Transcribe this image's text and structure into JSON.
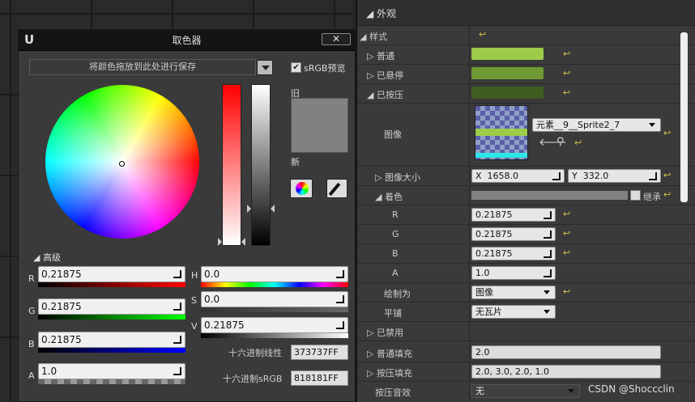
{
  "picker": {
    "title": "取色器",
    "save_bar": "将颜色拖放到此处进行保存",
    "srgb_label": "sRGB预览",
    "srgb_checked": true,
    "old_label": "旧",
    "new_label": "新",
    "advanced_label": "高级",
    "swatch_color": "#818181",
    "channels": [
      {
        "label": "R",
        "value": "0.21875"
      },
      {
        "label": "G",
        "value": "0.21875"
      },
      {
        "label": "B",
        "value": "0.21875"
      },
      {
        "label": "A",
        "value": "1.0"
      }
    ],
    "hsv": [
      {
        "label": "H",
        "value": "0.0"
      },
      {
        "label": "S",
        "value": "0.0"
      },
      {
        "label": "V",
        "value": "0.21875"
      }
    ],
    "hex_linear_label": "十六进制线性",
    "hex_linear": "373737FF",
    "hex_srgb_label": "十六进制sRGB",
    "hex_srgb": "818181FF"
  },
  "details": {
    "section_title": "外观",
    "style_label": "样式",
    "normal_label": "普通",
    "hovered_label": "已悬停",
    "pressed_label": "已按压",
    "image_label": "图像",
    "image_asset": "元素__9__Sprite2_7",
    "image_size_label": "图像大小",
    "size_x_prefix": "X",
    "size_x": "1658.0",
    "size_y_prefix": "Y",
    "size_y": "332.0",
    "tint_label": "着色",
    "inherit_label": "继承",
    "r_label": "R",
    "r_value": "0.21875",
    "g_label": "G",
    "g_value": "0.21875",
    "b_label": "B",
    "b_value": "0.21875",
    "a_label": "A",
    "a_value": "1.0",
    "draw_as_label": "绘制为",
    "draw_as_value": "图像",
    "tiling_label": "平铺",
    "tiling_value": "无瓦片",
    "disabled_label": "已禁用",
    "normal_padding_label": "普通填充",
    "normal_padding_value": "2.0",
    "pressed_padding_label": "按压填充",
    "pressed_padding_value": "2.0, 3.0, 2.0, 1.0",
    "pressed_sound_label": "按压音效",
    "pressed_sound_value": "无"
  },
  "watermark": "CSDN @Shoccclin"
}
